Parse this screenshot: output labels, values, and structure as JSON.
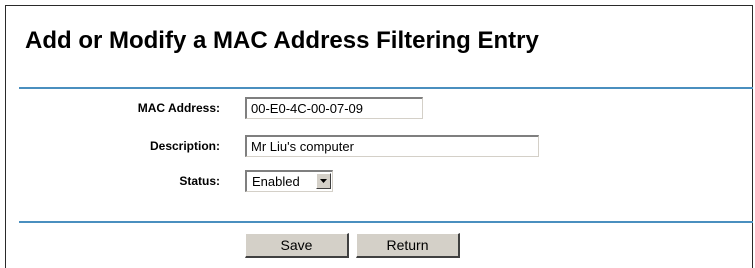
{
  "page": {
    "title": "Add or Modify a MAC Address Filtering Entry"
  },
  "form": {
    "mac_label": "MAC Address:",
    "mac_value": "00-E0-4C-00-07-09",
    "description_label": "Description:",
    "description_value": "Mr Liu's computer",
    "status_label": "Status:",
    "status_value": "Enabled"
  },
  "buttons": {
    "save_label": "Save",
    "return_label": "Return"
  },
  "colors": {
    "divider": "#4a8fbf",
    "button_face": "#d4d0c8"
  },
  "icons": {
    "status_dropdown": "chevron-down-icon"
  }
}
